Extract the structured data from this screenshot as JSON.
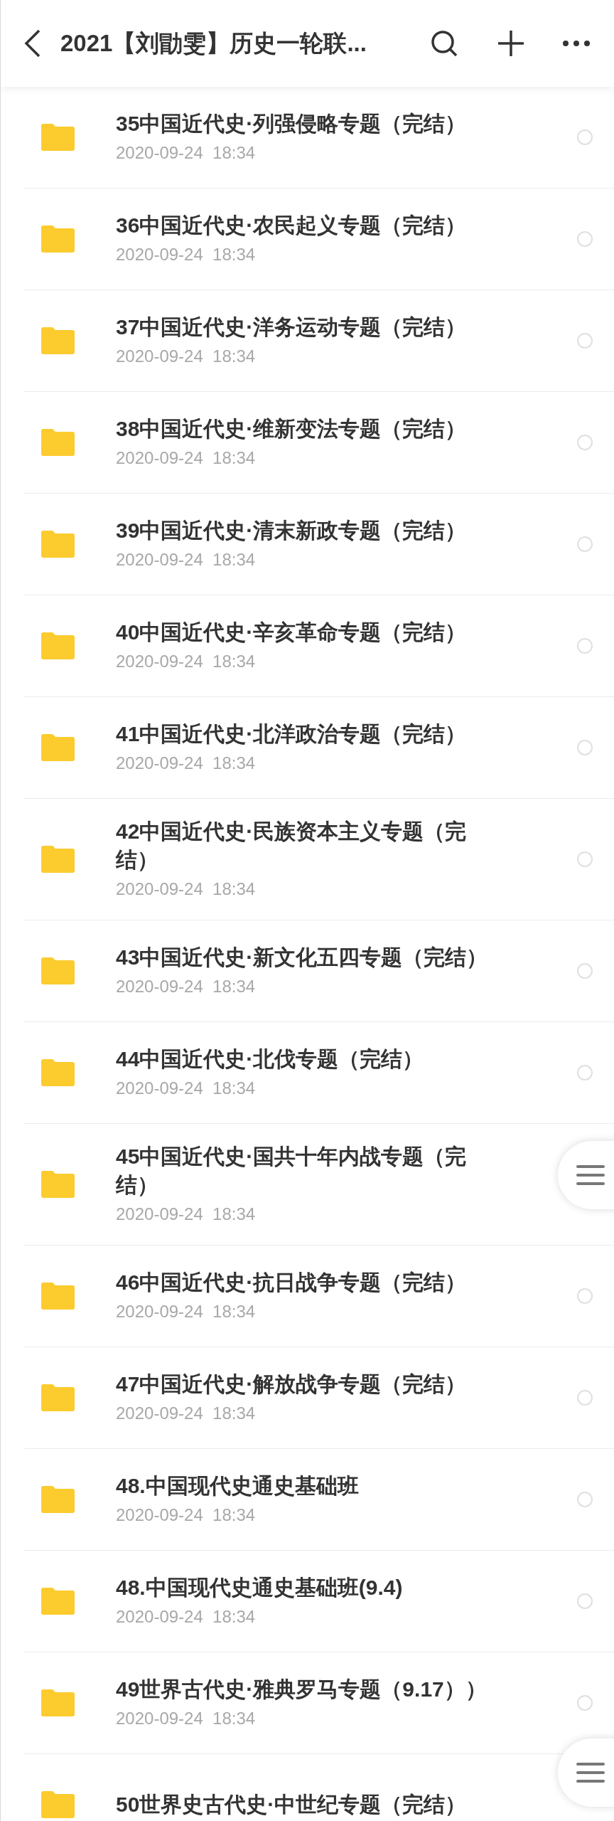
{
  "header": {
    "title": "2021【刘勖雯】历史一轮联..."
  },
  "files": [
    {
      "name": "35中国近代史·列强侵略专题（完结）",
      "date": "2020-09-24  18:34",
      "selected": false
    },
    {
      "name": "36中国近代史·农民起义专题（完结）",
      "date": "2020-09-24  18:34",
      "selected": false
    },
    {
      "name": "37中国近代史·洋务运动专题（完结）",
      "date": "2020-09-24  18:34",
      "selected": false
    },
    {
      "name": "38中国近代史·维新变法专题（完结）",
      "date": "2020-09-24  18:34",
      "selected": false
    },
    {
      "name": "39中国近代史·清末新政专题（完结）",
      "date": "2020-09-24  18:34",
      "selected": false
    },
    {
      "name": "40中国近代史·辛亥革命专题（完结）",
      "date": "2020-09-24  18:34",
      "selected": false
    },
    {
      "name": "41中国近代史·北洋政治专题（完结）",
      "date": "2020-09-24  18:34",
      "selected": false
    },
    {
      "name": "42中国近代史·民族资本主义专题（完结）",
      "date": "2020-09-24  18:34",
      "selected": false
    },
    {
      "name": "43中国近代史·新文化五四专题（完结）",
      "date": "2020-09-24  18:34",
      "selected": false
    },
    {
      "name": "44中国近代史·北伐专题（完结）",
      "date": "2020-09-24  18:34",
      "selected": false
    },
    {
      "name": "45中国近代史·国共十年内战专题（完结）",
      "date": "2020-09-24  18:34"
    },
    {
      "name": "46中国近代史·抗日战争专题（完结）",
      "date": "2020-09-24  18:34",
      "selected": false
    },
    {
      "name": "47中国近代史·解放战争专题（完结）",
      "date": "2020-09-24  18:34",
      "selected": false
    },
    {
      "name": "48.中国现代史通史基础班",
      "date": "2020-09-24  18:34",
      "selected": false
    },
    {
      "name": "48.中国现代史通史基础班(9.4)",
      "date": "2020-09-24  18:34",
      "selected": false
    },
    {
      "name": "49世界古代史·雅典罗马专题（9.17））",
      "date": "2020-09-24  18:34",
      "selected": false
    },
    {
      "name": "50世界史古代史·中世纪专题（完结）"
    }
  ]
}
